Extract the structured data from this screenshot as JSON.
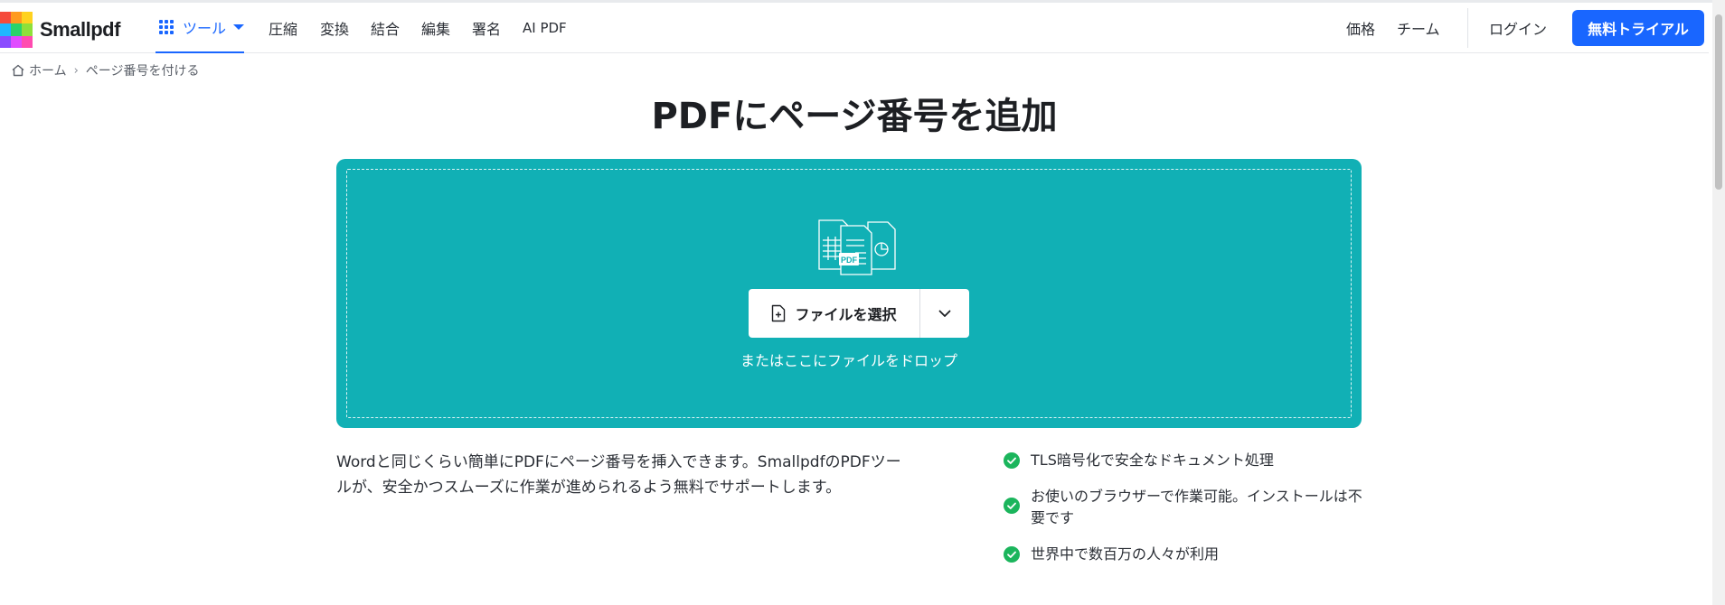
{
  "header": {
    "logo_text": "Smallpdf",
    "tools_label": "ツール",
    "nav": [
      "圧縮",
      "変換",
      "結合",
      "編集",
      "署名",
      "AI PDF"
    ],
    "pricing": "価格",
    "team": "チーム",
    "login": "ログイン",
    "trial": "無料トライアル"
  },
  "breadcrumb": {
    "home": "ホーム",
    "current": "ページ番号を付ける"
  },
  "page": {
    "title": "PDFにページ番号を追加"
  },
  "dropzone": {
    "choose_label": "ファイルを選択",
    "drop_hint": "またはここにファイルをドロップ",
    "icon_badge": "PDF"
  },
  "description": "Wordと同じくらい簡単にPDFにページ番号を挿入できます。SmallpdfのPDFツールが、安全かつスムーズに作業が進められるよう無料でサポートします。",
  "features": [
    "TLS暗号化で安全なドキュメント処理",
    "お使いのブラウザーで作業可能。インストールは不要です",
    "世界中で数百万の人々が利用"
  ],
  "colors": {
    "accent": "#1966ff",
    "dropzone": "#11b0b5",
    "check": "#1bb55c"
  }
}
